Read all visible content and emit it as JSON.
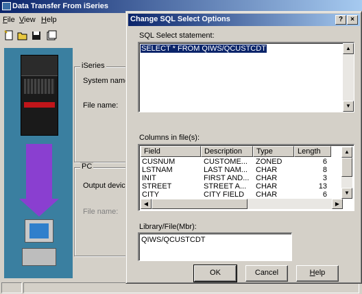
{
  "bg_window": {
    "title": "Data Transfer From iSeries",
    "menu": [
      {
        "label": "File",
        "underline": "F",
        "rest": "ile"
      },
      {
        "label": "View",
        "underline": "V",
        "rest": "iew"
      },
      {
        "label": "Help",
        "underline": "H",
        "rest": "elp"
      }
    ],
    "iseries_group": {
      "label": "iSeries",
      "system_name": "System name",
      "file_name": "File name:"
    },
    "pc_group": {
      "label": "PC",
      "output_device": "Output devic",
      "file_name": "File name:"
    }
  },
  "dialog": {
    "title": "Change SQL Select Options",
    "help_glyph": "?",
    "close_glyph": "×",
    "sql_label": "SQL Select statement:",
    "sql_text": "SELECT * FROM QIWS/QCUSTCDT",
    "columns_label": "Columns in file(s):",
    "columns": {
      "headers": [
        "Field",
        "Description",
        "Type",
        "Length"
      ],
      "rows": [
        [
          "CUSNUM",
          "CUSTOME...",
          "ZONED",
          "6"
        ],
        [
          "LSTNAM",
          "LAST NAM...",
          "CHAR",
          "8"
        ],
        [
          "INIT",
          "FIRST AND...",
          "CHAR",
          "3"
        ],
        [
          "STREET",
          "STREET A...",
          "CHAR",
          "13"
        ],
        [
          "CITY",
          "CITY FIELD",
          "CHAR",
          "6"
        ]
      ]
    },
    "library_label": "Library/File(Mbr):",
    "library_value": "QIWS/QCUSTCDT",
    "buttons": {
      "ok": "OK",
      "cancel": "Cancel",
      "help": "Help"
    }
  }
}
